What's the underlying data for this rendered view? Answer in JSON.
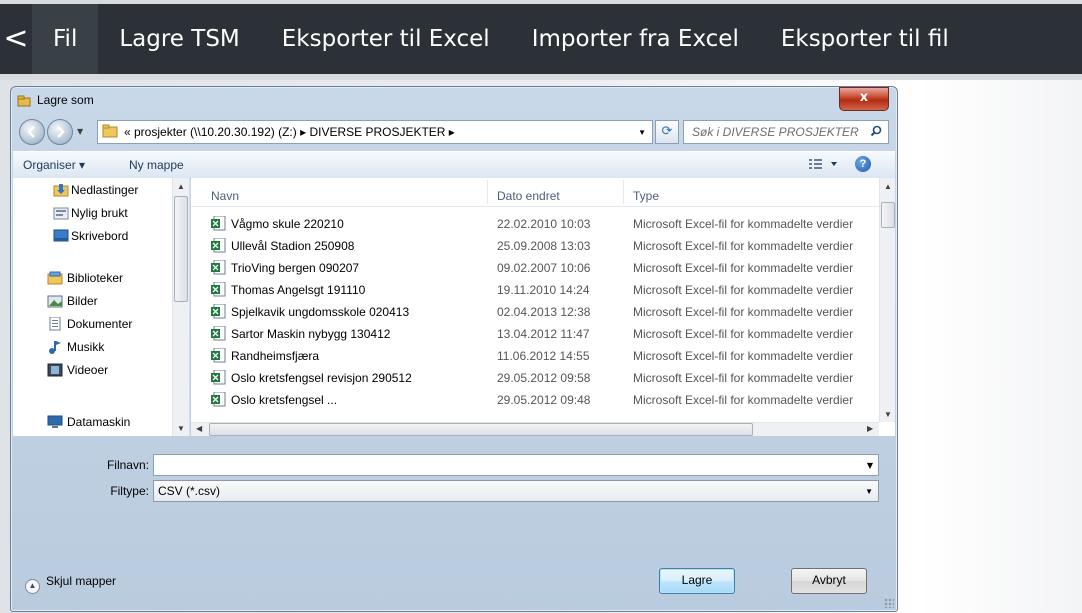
{
  "toolbar": {
    "back_symbol": "<",
    "items": [
      "Fil",
      "Lagre TSM",
      "Eksporter til Excel",
      "Importer fra Excel",
      "Eksporter til fil"
    ],
    "background": "#2b3136",
    "active_background": "#3a4146"
  },
  "dialog": {
    "title": "Lagre som",
    "close_symbol": "x",
    "address_path": "« prosjekter (\\\\10.20.30.192) (Z:) ▸ DIVERSE PROSJEKTER ▸",
    "search_placeholder": "Søk i DIVERSE PROSJEKTER",
    "commands": {
      "organize": "Organiser ▾",
      "new_folder": "Ny mappe"
    },
    "nav_pane": [
      {
        "label": "Nedlastinger",
        "icon": "downloads-folder-icon"
      },
      {
        "label": "Nylig brukt",
        "icon": "recent-places-icon"
      },
      {
        "label": "Skrivebord",
        "icon": "desktop-icon"
      },
      {
        "label": "Biblioteker",
        "icon": "libraries-icon"
      },
      {
        "label": "Bilder",
        "icon": "pictures-icon"
      },
      {
        "label": "Dokumenter",
        "icon": "documents-icon"
      },
      {
        "label": "Musikk",
        "icon": "music-icon"
      },
      {
        "label": "Videoer",
        "icon": "videos-icon"
      },
      {
        "label": "Datamaskin",
        "icon": "computer-icon"
      }
    ],
    "columns": {
      "name": "Navn",
      "date": "Dato endret",
      "type": "Type"
    },
    "files": [
      {
        "name": "Vågmo skule 220210",
        "date": "22.02.2010 10:03",
        "type": "Microsoft Excel-fil for kommadelte verdier"
      },
      {
        "name": "Ullevål Stadion 250908",
        "date": "25.09.2008 13:03",
        "type": "Microsoft Excel-fil for kommadelte verdier"
      },
      {
        "name": "TrioVing bergen 090207",
        "date": "09.02.2007 10:06",
        "type": "Microsoft Excel-fil for kommadelte verdier"
      },
      {
        "name": "Thomas Angelsgt 191110",
        "date": "19.11.2010 14:24",
        "type": "Microsoft Excel-fil for kommadelte verdier"
      },
      {
        "name": "Spjelkavik ungdomsskole 020413",
        "date": "02.04.2013 12:38",
        "type": "Microsoft Excel-fil for kommadelte verdier"
      },
      {
        "name": "Sartor Maskin nybygg 130412",
        "date": "13.04.2012 11:47",
        "type": "Microsoft Excel-fil for kommadelte verdier"
      },
      {
        "name": "Randheimsfjæra",
        "date": "11.06.2012 14:55",
        "type": "Microsoft Excel-fil for kommadelte verdier"
      },
      {
        "name": "Oslo kretsfengsel revisjon 290512",
        "date": "29.05.2012 09:58",
        "type": "Microsoft Excel-fil for kommadelte verdier"
      },
      {
        "name": "Oslo kretsfengsel ...",
        "date": "29.05.2012 09:48",
        "type": "Microsoft Excel-fil for kommadelte verdier"
      }
    ],
    "filename_label": "Filnavn:",
    "filename_value": "",
    "filetype_label": "Filtype:",
    "filetype_value": "CSV (*.csv)",
    "hide_folders": "Skjul mapper",
    "save_button": "Lagre",
    "cancel_button": "Avbryt"
  }
}
